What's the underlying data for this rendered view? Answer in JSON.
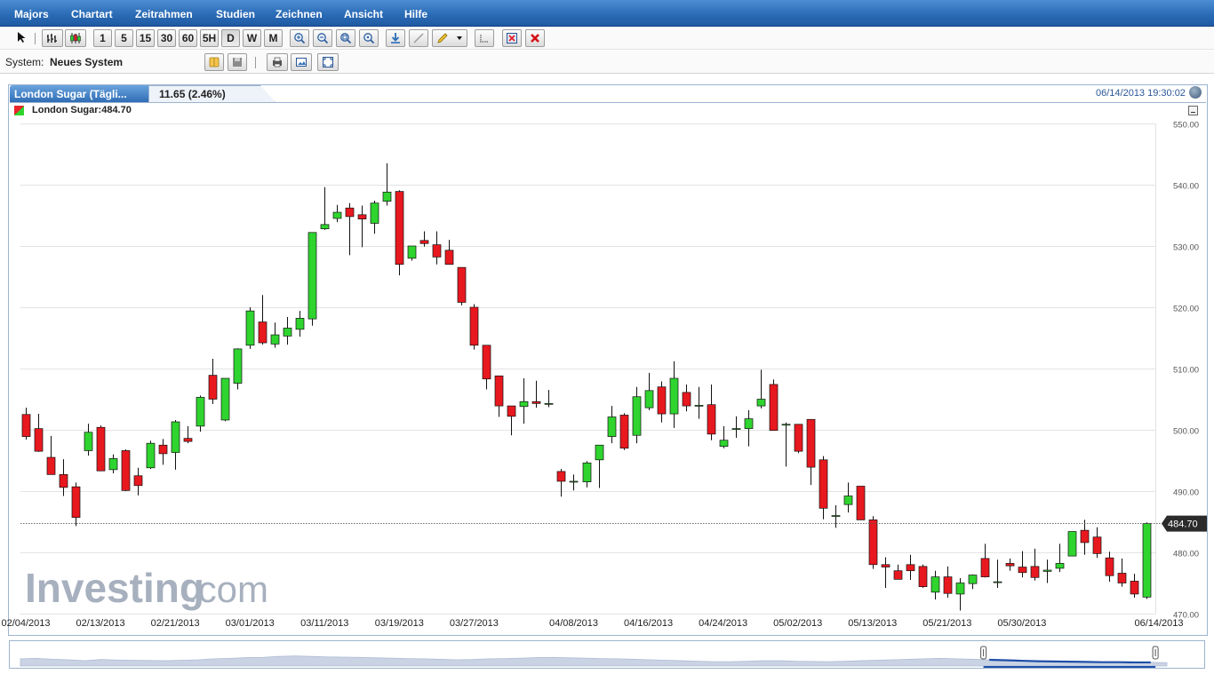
{
  "menu": [
    "Majors",
    "Chartart",
    "Zeitrahmen",
    "Studien",
    "Zeichnen",
    "Ansicht",
    "Hilfe"
  ],
  "toolbar": {
    "timeframes": [
      "1",
      "5",
      "15",
      "30",
      "60",
      "5H",
      "D",
      "W",
      "M"
    ],
    "selected_timeframe": "D"
  },
  "system": {
    "label": "System:",
    "value": "Neues System"
  },
  "tab": {
    "title": "London Sugar (Tägli...",
    "change": "11.65 (2.46%)"
  },
  "timestamp": "06/14/2013 19:30:02",
  "legend": "London Sugar:484.70",
  "watermark": {
    "brand": "Investing",
    "suffix": ".com"
  },
  "colors": {
    "up": "#2fd42f",
    "down": "#e8181f",
    "accent": "#2b6cb7",
    "navigator": "#1f4fa8"
  },
  "chart_data": {
    "type": "candlestick",
    "title": "London Sugar",
    "last_price": 484.7,
    "last_price_label": "484.70",
    "ylim": [
      470,
      550
    ],
    "yticks": [
      "470.00",
      "480.00",
      "490.00",
      "500.00",
      "510.00",
      "520.00",
      "530.00",
      "540.00",
      "550.00"
    ],
    "xticks": [
      "02/04/2013",
      "02/13/2013",
      "02/21/2013",
      "03/01/2013",
      "03/11/2013",
      "03/19/2013",
      "03/27/2013",
      "04/08/2013",
      "04/16/2013",
      "04/24/2013",
      "05/02/2013",
      "05/13/2013",
      "05/21/2013",
      "05/30/2013",
      "06/14/2013"
    ],
    "xtick_index": [
      0,
      6,
      12,
      18,
      24,
      30,
      36,
      44,
      50,
      56,
      62,
      68,
      74,
      80,
      91
    ],
    "series": [
      {
        "o": 502.5,
        "h": 503.6,
        "l": 498.4,
        "c": 498.9
      },
      {
        "o": 500.2,
        "h": 502.6,
        "l": 496.4,
        "c": 496.5
      },
      {
        "o": 495.5,
        "h": 499.0,
        "l": 492.7,
        "c": 492.7
      },
      {
        "o": 492.7,
        "h": 495.2,
        "l": 489.2,
        "c": 490.6
      },
      {
        "o": 490.7,
        "h": 491.4,
        "l": 484.3,
        "c": 485.7
      },
      {
        "o": 496.6,
        "h": 501.0,
        "l": 495.8,
        "c": 499.6
      },
      {
        "o": 500.4,
        "h": 500.7,
        "l": 493.3,
        "c": 493.3
      },
      {
        "o": 493.5,
        "h": 496.0,
        "l": 492.9,
        "c": 495.3
      },
      {
        "o": 496.6,
        "h": 496.8,
        "l": 490.0,
        "c": 490.1
      },
      {
        "o": 492.5,
        "h": 493.8,
        "l": 489.3,
        "c": 490.9
      },
      {
        "o": 493.8,
        "h": 498.2,
        "l": 493.6,
        "c": 497.8
      },
      {
        "o": 497.5,
        "h": 498.5,
        "l": 494.3,
        "c": 496.1
      },
      {
        "o": 496.3,
        "h": 501.6,
        "l": 493.5,
        "c": 501.3
      },
      {
        "o": 498.6,
        "h": 500.6,
        "l": 497.8,
        "c": 498.1
      },
      {
        "o": 500.6,
        "h": 505.6,
        "l": 499.7,
        "c": 505.3
      },
      {
        "o": 508.9,
        "h": 511.6,
        "l": 504.2,
        "c": 505.0
      },
      {
        "o": 501.6,
        "h": 508.4,
        "l": 501.4,
        "c": 508.4
      },
      {
        "o": 507.6,
        "h": 513.3,
        "l": 506.6,
        "c": 513.2
      },
      {
        "o": 513.8,
        "h": 520.0,
        "l": 513.2,
        "c": 519.4
      },
      {
        "o": 517.6,
        "h": 522.0,
        "l": 513.9,
        "c": 514.2
      },
      {
        "o": 514.0,
        "h": 517.5,
        "l": 513.4,
        "c": 515.5
      },
      {
        "o": 515.3,
        "h": 518.4,
        "l": 513.9,
        "c": 516.6
      },
      {
        "o": 516.4,
        "h": 519.4,
        "l": 515.2,
        "c": 518.2
      },
      {
        "o": 518.1,
        "h": 530.4,
        "l": 517.0,
        "c": 532.2
      },
      {
        "o": 532.8,
        "h": 539.6,
        "l": 532.6,
        "c": 533.5
      },
      {
        "o": 534.5,
        "h": 536.7,
        "l": 533.9,
        "c": 535.5
      },
      {
        "o": 536.2,
        "h": 537.0,
        "l": 528.5,
        "c": 534.8
      },
      {
        "o": 535.1,
        "h": 536.6,
        "l": 529.8,
        "c": 534.4
      },
      {
        "o": 533.7,
        "h": 537.4,
        "l": 532.0,
        "c": 537.0
      },
      {
        "o": 537.3,
        "h": 543.5,
        "l": 536.6,
        "c": 538.8
      },
      {
        "o": 538.9,
        "h": 539.1,
        "l": 525.2,
        "c": 527.0
      },
      {
        "o": 528.0,
        "h": 530.0,
        "l": 527.6,
        "c": 530.0
      },
      {
        "o": 530.9,
        "h": 532.4,
        "l": 529.9,
        "c": 530.4
      },
      {
        "o": 530.2,
        "h": 532.4,
        "l": 527.0,
        "c": 528.2
      },
      {
        "o": 529.3,
        "h": 531.0,
        "l": 527.0,
        "c": 527.0
      },
      {
        "o": 526.5,
        "h": 526.5,
        "l": 520.3,
        "c": 520.8
      },
      {
        "o": 520.0,
        "h": 520.5,
        "l": 513.1,
        "c": 513.8
      },
      {
        "o": 513.8,
        "h": 513.8,
        "l": 506.6,
        "c": 508.3
      },
      {
        "o": 508.8,
        "h": 508.8,
        "l": 502.1,
        "c": 503.9
      },
      {
        "o": 503.9,
        "h": 503.9,
        "l": 499.1,
        "c": 502.2
      },
      {
        "o": 503.8,
        "h": 508.4,
        "l": 501.0,
        "c": 504.6
      },
      {
        "o": 504.6,
        "h": 508.0,
        "l": 503.6,
        "c": 504.3
      },
      {
        "o": 504.3,
        "h": 506.5,
        "l": 503.7,
        "c": 504.3
      },
      {
        "o": 493.2,
        "h": 493.6,
        "l": 489.1,
        "c": 491.6
      },
      {
        "o": 491.6,
        "h": 492.7,
        "l": 490.1,
        "c": 491.6
      },
      {
        "o": 491.5,
        "h": 494.9,
        "l": 490.6,
        "c": 494.6
      },
      {
        "o": 495.1,
        "h": 497.5,
        "l": 490.5,
        "c": 497.5
      },
      {
        "o": 498.9,
        "h": 503.9,
        "l": 497.8,
        "c": 502.1
      },
      {
        "o": 502.4,
        "h": 502.7,
        "l": 496.7,
        "c": 497.0
      },
      {
        "o": 499.1,
        "h": 507.0,
        "l": 497.8,
        "c": 505.4
      },
      {
        "o": 503.6,
        "h": 509.3,
        "l": 503.2,
        "c": 506.4
      },
      {
        "o": 507.0,
        "h": 507.9,
        "l": 501.2,
        "c": 502.6
      },
      {
        "o": 502.6,
        "h": 511.2,
        "l": 500.3,
        "c": 508.4
      },
      {
        "o": 506.1,
        "h": 507.4,
        "l": 503.0,
        "c": 503.9
      },
      {
        "o": 504.0,
        "h": 507.0,
        "l": 501.8,
        "c": 504.0
      },
      {
        "o": 504.1,
        "h": 507.4,
        "l": 498.3,
        "c": 499.3
      },
      {
        "o": 497.3,
        "h": 500.6,
        "l": 497.0,
        "c": 498.3
      },
      {
        "o": 500.2,
        "h": 502.2,
        "l": 498.7,
        "c": 500.2
      },
      {
        "o": 500.2,
        "h": 503.2,
        "l": 497.3,
        "c": 501.8
      },
      {
        "o": 503.9,
        "h": 509.8,
        "l": 503.5,
        "c": 505.0
      },
      {
        "o": 507.4,
        "h": 508.2,
        "l": 499.9,
        "c": 499.9
      },
      {
        "o": 500.9,
        "h": 501.2,
        "l": 494.0,
        "c": 500.9
      },
      {
        "o": 500.9,
        "h": 500.9,
        "l": 496.2,
        "c": 496.5
      },
      {
        "o": 501.7,
        "h": 501.7,
        "l": 491.0,
        "c": 493.9
      },
      {
        "o": 495.1,
        "h": 495.7,
        "l": 485.4,
        "c": 487.2
      },
      {
        "o": 486.0,
        "h": 487.7,
        "l": 484.0,
        "c": 486.0
      },
      {
        "o": 487.8,
        "h": 491.4,
        "l": 486.5,
        "c": 489.2
      },
      {
        "o": 490.8,
        "h": 490.8,
        "l": 485.3,
        "c": 485.3
      },
      {
        "o": 485.3,
        "h": 485.9,
        "l": 477.3,
        "c": 478.0
      },
      {
        "o": 478.0,
        "h": 479.2,
        "l": 474.2,
        "c": 477.6
      },
      {
        "o": 477.0,
        "h": 478.0,
        "l": 475.6,
        "c": 475.6
      },
      {
        "o": 478.0,
        "h": 479.6,
        "l": 475.5,
        "c": 477.0
      },
      {
        "o": 477.7,
        "h": 478.0,
        "l": 474.2,
        "c": 474.4
      },
      {
        "o": 473.5,
        "h": 477.0,
        "l": 472.3,
        "c": 476.0
      },
      {
        "o": 476.0,
        "h": 477.7,
        "l": 472.6,
        "c": 473.3
      },
      {
        "o": 473.2,
        "h": 475.8,
        "l": 470.5,
        "c": 475.0
      },
      {
        "o": 474.9,
        "h": 476.4,
        "l": 474.0,
        "c": 476.3
      },
      {
        "o": 479.0,
        "h": 481.4,
        "l": 475.9,
        "c": 476.0
      },
      {
        "o": 475.2,
        "h": 478.8,
        "l": 474.2,
        "c": 475.2
      },
      {
        "o": 478.2,
        "h": 479.0,
        "l": 477.0,
        "c": 477.8
      },
      {
        "o": 477.6,
        "h": 480.2,
        "l": 475.9,
        "c": 476.7
      },
      {
        "o": 477.7,
        "h": 480.6,
        "l": 475.4,
        "c": 475.9
      },
      {
        "o": 476.9,
        "h": 478.8,
        "l": 475.0,
        "c": 477.1
      },
      {
        "o": 477.4,
        "h": 481.4,
        "l": 476.8,
        "c": 478.2
      },
      {
        "o": 479.4,
        "h": 483.4,
        "l": 479.4,
        "c": 483.4
      },
      {
        "o": 483.6,
        "h": 485.3,
        "l": 479.6,
        "c": 481.6
      },
      {
        "o": 482.5,
        "h": 484.1,
        "l": 479.1,
        "c": 479.8
      },
      {
        "o": 479.1,
        "h": 480.1,
        "l": 475.2,
        "c": 476.2
      },
      {
        "o": 476.6,
        "h": 479.0,
        "l": 474.4,
        "c": 475.0
      },
      {
        "o": 475.3,
        "h": 476.5,
        "l": 472.6,
        "c": 473.2
      },
      {
        "o": 472.7,
        "h": 484.9,
        "l": 472.4,
        "c": 484.7
      }
    ],
    "navigator": [
      0.3,
      0.32,
      0.28,
      0.26,
      0.22,
      0.27,
      0.25,
      0.24,
      0.23,
      0.22,
      0.24,
      0.26,
      0.3,
      0.32,
      0.35,
      0.36,
      0.4,
      0.42,
      0.4,
      0.38,
      0.37,
      0.36,
      0.34,
      0.33,
      0.31,
      0.3,
      0.28,
      0.26,
      0.27,
      0.3,
      0.31,
      0.33,
      0.35,
      0.36,
      0.34,
      0.33,
      0.31,
      0.3,
      0.28,
      0.26,
      0.24,
      0.22,
      0.2,
      0.18,
      0.18,
      0.2,
      0.22,
      0.22,
      0.2,
      0.19,
      0.18,
      0.2,
      0.22,
      0.24,
      0.26,
      0.28,
      0.3,
      0.32,
      0.3,
      0.28,
      0.26,
      0.24,
      0.22,
      0.2,
      0.19,
      0.18,
      0.17,
      0.16,
      0.16,
      0.15,
      0.15,
      0.14
    ],
    "navigator_window": [
      0.84,
      0.99
    ]
  }
}
